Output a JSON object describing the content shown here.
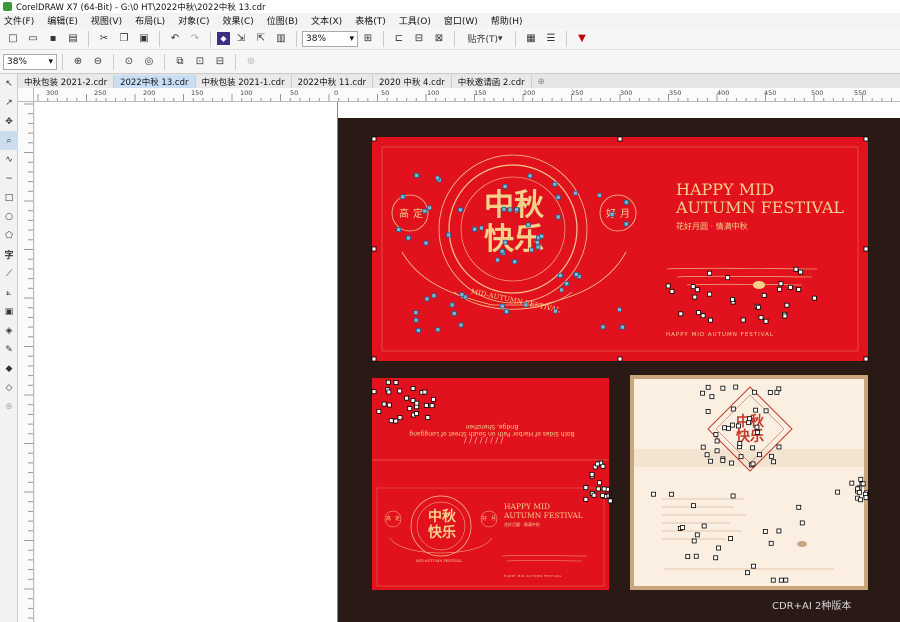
{
  "window": {
    "title": "CorelDRAW X7 (64-Bit) - G:\\0 HT\\2022中秋\\2022中秋 13.cdr"
  },
  "menu": [
    "文件(F)",
    "编辑(E)",
    "视图(V)",
    "布局(L)",
    "对象(C)",
    "效果(C)",
    "位图(B)",
    "文本(X)",
    "表格(T)",
    "工具(O)",
    "窗口(W)",
    "帮助(H)"
  ],
  "toolbar": {
    "zoom_value": "38%",
    "snap_label": "贴齐(T)"
  },
  "propbar": {
    "zoom_value": "38%"
  },
  "tabs": [
    {
      "label": "中秋包装 2021-2.cdr",
      "active": false
    },
    {
      "label": "2022中秋 13.cdr",
      "active": true
    },
    {
      "label": "中秋包装 2021-1.cdr",
      "active": false
    },
    {
      "label": "2022中秋 11.cdr",
      "active": false
    },
    {
      "label": "2020 中秋 4.cdr",
      "active": false
    },
    {
      "label": "中秋邀请函 2.cdr",
      "active": false
    }
  ],
  "ruler": {
    "h_ticks": [
      "300",
      "250",
      "200",
      "150",
      "100",
      "50",
      "0",
      "50",
      "100",
      "150",
      "200",
      "250",
      "300",
      "350",
      "400",
      "450",
      "500",
      "550"
    ]
  },
  "card1": {
    "title_cn_1": "中秋",
    "title_cn_2": "快乐",
    "left_seal": "高",
    "left_seal_2": "定",
    "right_seal": "好",
    "right_seal_2": "月",
    "banner": "MID-AUTUMN FESTIVAL",
    "headline_1": "HAPPY MID",
    "headline_2": "AUTUMN FESTIVAL",
    "slogan": "花好月圆 · 情满中秋",
    "footer": "HAPPY   MID   AUTUMN   FESTIVAL"
  },
  "card2": {
    "title_cn_1": "中秋",
    "title_cn_2": "快乐",
    "seal_l": "高",
    "seal_l2": "定",
    "seal_r": "好",
    "seal_r2": "月",
    "banner": "MID-AUTUMN FESTIVAL",
    "headline_1": "HAPPY MID",
    "headline_2": "AUTUMN FESTIVAL",
    "slogan": "花好月圆 · 情满中秋",
    "footer": "HAPPY   MID   AUTUMN   FESTIVAL",
    "inside_text": "Both Sides of Harbor Path on South Street of Longgang Bridge, Shenzhen",
    "inside_mark": "/ / / /   / / / /"
  },
  "card3": {
    "title_cn_1": "中秋",
    "title_cn_2": "快乐"
  },
  "watermark": "CDR+AI 2种版本",
  "colors": {
    "card_red": "#e1121e",
    "gold": "#f4d08a",
    "dark_bg": "#2a1a16"
  }
}
